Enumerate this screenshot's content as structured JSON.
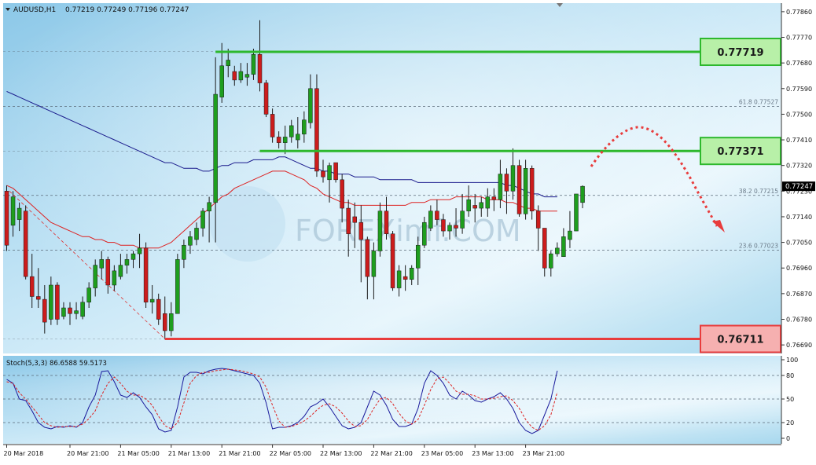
{
  "chart_data": [
    {
      "type": "candlestick",
      "title": "AUDUSD,H1",
      "ohlc_header": "0.77219 0.77249 0.77196 0.77247",
      "ylim": [
        0.7666,
        0.7789
      ],
      "y_tick_labels": [
        "0.77860",
        "0.77770",
        "0.77680",
        "0.77590",
        "0.77500",
        "0.77410",
        "0.77320",
        "0.77230",
        "0.77140",
        "0.77050",
        "0.76960",
        "0.76870",
        "0.76780",
        "0.76690"
      ],
      "x_tick_labels": [
        "20 Mar 2018",
        "20 Mar 21:00",
        "21 Mar 05:00",
        "21 Mar 13:00",
        "21 Mar 21:00",
        "22 Mar 05:00",
        "22 Mar 13:00",
        "22 Mar 21:00",
        "23 Mar 05:00",
        "23 Mar 13:00",
        "23 Mar 21:00"
      ],
      "x_tick_bar_index": [
        0,
        10,
        18,
        26,
        34,
        42,
        50,
        58,
        66,
        74,
        82
      ],
      "current_price": "0.77247",
      "bullish_color": "#1e9e1e",
      "bearish_color": "#cc1c1c",
      "moving_averages": [
        {
          "color": "#1a1a8c",
          "values": [
            0.7758,
            0.7757,
            0.7756,
            0.7755,
            0.7754,
            0.7753,
            0.7752,
            0.7751,
            0.775,
            0.7749,
            0.7748,
            0.7747,
            0.7746,
            0.7745,
            0.7744,
            0.7743,
            0.7742,
            0.7741,
            0.774,
            0.7739,
            0.7738,
            0.7737,
            0.7736,
            0.7735,
            0.7734,
            0.7733,
            0.7733,
            0.7732,
            0.7731,
            0.7731,
            0.7731,
            0.773,
            0.773,
            0.7731,
            0.7732,
            0.7732,
            0.7733,
            0.7733,
            0.7733,
            0.7734,
            0.7734,
            0.7734,
            0.7734,
            0.7735,
            0.7735,
            0.7734,
            0.7733,
            0.7732,
            0.7731,
            0.7731,
            0.773,
            0.773,
            0.7729,
            0.7729,
            0.7729,
            0.7728,
            0.7728,
            0.7728,
            0.7728,
            0.7727,
            0.7727,
            0.7727,
            0.7727,
            0.7727,
            0.7727,
            0.7726,
            0.7726,
            0.7726,
            0.7726,
            0.7726,
            0.7726,
            0.7726,
            0.7726,
            0.7726,
            0.7726,
            0.7726,
            0.7726,
            0.7726,
            0.7726,
            0.7725,
            0.7725,
            0.7724,
            0.7723,
            0.7722,
            0.7722,
            0.7721,
            0.7721,
            0.7721
          ]
        },
        {
          "color": "#dd2222",
          "values": [
            0.7725,
            0.7724,
            0.7722,
            0.772,
            0.7718,
            0.7716,
            0.7714,
            0.7712,
            0.7711,
            0.771,
            0.7709,
            0.7708,
            0.7707,
            0.7707,
            0.7706,
            0.7706,
            0.7705,
            0.7705,
            0.7704,
            0.7704,
            0.7704,
            0.7703,
            0.7703,
            0.7703,
            0.7703,
            0.7704,
            0.7705,
            0.7707,
            0.7709,
            0.7711,
            0.7713,
            0.7715,
            0.7717,
            0.7719,
            0.7721,
            0.7722,
            0.7724,
            0.7725,
            0.7726,
            0.7727,
            0.7728,
            0.7729,
            0.773,
            0.773,
            0.773,
            0.7729,
            0.7728,
            0.7727,
            0.7725,
            0.7724,
            0.7722,
            0.7721,
            0.772,
            0.7719,
            0.7719,
            0.7718,
            0.7718,
            0.7718,
            0.7718,
            0.7718,
            0.7718,
            0.7718,
            0.7718,
            0.7718,
            0.7719,
            0.7719,
            0.7719,
            0.772,
            0.772,
            0.772,
            0.772,
            0.7721,
            0.7721,
            0.7721,
            0.7721,
            0.7721,
            0.772,
            0.772,
            0.772,
            0.7719,
            0.7719,
            0.7718,
            0.7717,
            0.7717,
            0.7716,
            0.7716,
            0.7716,
            0.7716
          ]
        }
      ],
      "candles": [
        {
          "o": 0.7723,
          "h": 0.7725,
          "l": 0.7702,
          "c": 0.7704
        },
        {
          "o": 0.7711,
          "h": 0.7723,
          "l": 0.7707,
          "c": 0.7721
        },
        {
          "o": 0.7713,
          "h": 0.7719,
          "l": 0.7709,
          "c": 0.7717
        },
        {
          "o": 0.7716,
          "h": 0.7718,
          "l": 0.7692,
          "c": 0.7693
        },
        {
          "o": 0.7693,
          "h": 0.7701,
          "l": 0.7682,
          "c": 0.7686
        },
        {
          "o": 0.7686,
          "h": 0.7696,
          "l": 0.7682,
          "c": 0.7685
        },
        {
          "o": 0.7685,
          "h": 0.769,
          "l": 0.7673,
          "c": 0.7677
        },
        {
          "o": 0.7678,
          "h": 0.7693,
          "l": 0.7676,
          "c": 0.769
        },
        {
          "o": 0.769,
          "h": 0.7691,
          "l": 0.7676,
          "c": 0.7678
        },
        {
          "o": 0.7679,
          "h": 0.7684,
          "l": 0.7678,
          "c": 0.7682
        },
        {
          "o": 0.7682,
          "h": 0.7684,
          "l": 0.7676,
          "c": 0.768
        },
        {
          "o": 0.768,
          "h": 0.7684,
          "l": 0.7678,
          "c": 0.7681
        },
        {
          "o": 0.7679,
          "h": 0.7686,
          "l": 0.7678,
          "c": 0.7684
        },
        {
          "o": 0.7684,
          "h": 0.7691,
          "l": 0.7682,
          "c": 0.7689
        },
        {
          "o": 0.7689,
          "h": 0.7699,
          "l": 0.7686,
          "c": 0.7697
        },
        {
          "o": 0.7696,
          "h": 0.7702,
          "l": 0.7692,
          "c": 0.7699
        },
        {
          "o": 0.7699,
          "h": 0.77,
          "l": 0.7687,
          "c": 0.769
        },
        {
          "o": 0.769,
          "h": 0.7697,
          "l": 0.7688,
          "c": 0.7695
        },
        {
          "o": 0.7693,
          "h": 0.7701,
          "l": 0.7692,
          "c": 0.7697
        },
        {
          "o": 0.7697,
          "h": 0.7701,
          "l": 0.7694,
          "c": 0.7699
        },
        {
          "o": 0.7699,
          "h": 0.7702,
          "l": 0.7696,
          "c": 0.7701
        },
        {
          "o": 0.7701,
          "h": 0.7708,
          "l": 0.7696,
          "c": 0.7703
        },
        {
          "o": 0.7703,
          "h": 0.7705,
          "l": 0.7682,
          "c": 0.7684
        },
        {
          "o": 0.7684,
          "h": 0.769,
          "l": 0.768,
          "c": 0.7685
        },
        {
          "o": 0.7685,
          "h": 0.7687,
          "l": 0.7676,
          "c": 0.7678
        },
        {
          "o": 0.768,
          "h": 0.7686,
          "l": 0.7671,
          "c": 0.7674
        },
        {
          "o": 0.7674,
          "h": 0.7684,
          "l": 0.7672,
          "c": 0.768
        },
        {
          "o": 0.768,
          "h": 0.7701,
          "l": 0.768,
          "c": 0.7699
        },
        {
          "o": 0.7699,
          "h": 0.7706,
          "l": 0.7696,
          "c": 0.7704
        },
        {
          "o": 0.7704,
          "h": 0.7709,
          "l": 0.7701,
          "c": 0.7707
        },
        {
          "o": 0.7706,
          "h": 0.7712,
          "l": 0.7704,
          "c": 0.771
        },
        {
          "o": 0.771,
          "h": 0.7717,
          "l": 0.7707,
          "c": 0.7716
        },
        {
          "o": 0.7716,
          "h": 0.7721,
          "l": 0.7705,
          "c": 0.7719
        },
        {
          "o": 0.7719,
          "h": 0.777,
          "l": 0.7705,
          "c": 0.7757
        },
        {
          "o": 0.7756,
          "h": 0.7775,
          "l": 0.7754,
          "c": 0.7767
        },
        {
          "o": 0.7767,
          "h": 0.7773,
          "l": 0.7763,
          "c": 0.7769
        },
        {
          "o": 0.7765,
          "h": 0.7767,
          "l": 0.776,
          "c": 0.7762
        },
        {
          "o": 0.7762,
          "h": 0.7768,
          "l": 0.7761,
          "c": 0.7765
        },
        {
          "o": 0.7763,
          "h": 0.7768,
          "l": 0.776,
          "c": 0.7764
        },
        {
          "o": 0.7764,
          "h": 0.7773,
          "l": 0.7762,
          "c": 0.7771
        },
        {
          "o": 0.7771,
          "h": 0.7783,
          "l": 0.7758,
          "c": 0.7761
        },
        {
          "o": 0.7761,
          "h": 0.7762,
          "l": 0.7749,
          "c": 0.775
        },
        {
          "o": 0.775,
          "h": 0.7752,
          "l": 0.774,
          "c": 0.7742
        },
        {
          "o": 0.7742,
          "h": 0.7744,
          "l": 0.7738,
          "c": 0.774
        },
        {
          "o": 0.774,
          "h": 0.7746,
          "l": 0.7736,
          "c": 0.7742
        },
        {
          "o": 0.7742,
          "h": 0.7748,
          "l": 0.774,
          "c": 0.7746
        },
        {
          "o": 0.7741,
          "h": 0.7749,
          "l": 0.7738,
          "c": 0.7743
        },
        {
          "o": 0.7743,
          "h": 0.7751,
          "l": 0.774,
          "c": 0.7748
        },
        {
          "o": 0.7747,
          "h": 0.7764,
          "l": 0.7745,
          "c": 0.7759
        },
        {
          "o": 0.7759,
          "h": 0.7764,
          "l": 0.7728,
          "c": 0.773
        },
        {
          "o": 0.773,
          "h": 0.7734,
          "l": 0.7726,
          "c": 0.7728
        },
        {
          "o": 0.7727,
          "h": 0.7733,
          "l": 0.7719,
          "c": 0.7732
        },
        {
          "o": 0.7733,
          "h": 0.7733,
          "l": 0.7726,
          "c": 0.7727
        },
        {
          "o": 0.7727,
          "h": 0.7729,
          "l": 0.7712,
          "c": 0.7717
        },
        {
          "o": 0.7717,
          "h": 0.772,
          "l": 0.77,
          "c": 0.7708
        },
        {
          "o": 0.7714,
          "h": 0.7719,
          "l": 0.7703,
          "c": 0.7712
        },
        {
          "o": 0.7712,
          "h": 0.7718,
          "l": 0.7691,
          "c": 0.7706
        },
        {
          "o": 0.7706,
          "h": 0.7707,
          "l": 0.7685,
          "c": 0.7693
        },
        {
          "o": 0.7693,
          "h": 0.7705,
          "l": 0.7685,
          "c": 0.7702
        },
        {
          "o": 0.7702,
          "h": 0.7719,
          "l": 0.77,
          "c": 0.7716
        },
        {
          "o": 0.7716,
          "h": 0.7721,
          "l": 0.7706,
          "c": 0.7708
        },
        {
          "o": 0.7708,
          "h": 0.7709,
          "l": 0.7688,
          "c": 0.7689
        },
        {
          "o": 0.7689,
          "h": 0.7697,
          "l": 0.7686,
          "c": 0.7695
        },
        {
          "o": 0.7693,
          "h": 0.7697,
          "l": 0.7688,
          "c": 0.7692
        },
        {
          "o": 0.7692,
          "h": 0.7697,
          "l": 0.769,
          "c": 0.7696
        },
        {
          "o": 0.7696,
          "h": 0.7707,
          "l": 0.769,
          "c": 0.7704
        },
        {
          "o": 0.7704,
          "h": 0.7714,
          "l": 0.7703,
          "c": 0.7712
        },
        {
          "o": 0.771,
          "h": 0.7718,
          "l": 0.7709,
          "c": 0.7716
        },
        {
          "o": 0.7716,
          "h": 0.772,
          "l": 0.7711,
          "c": 0.7713
        },
        {
          "o": 0.7713,
          "h": 0.7715,
          "l": 0.7707,
          "c": 0.7709
        },
        {
          "o": 0.7709,
          "h": 0.7712,
          "l": 0.7706,
          "c": 0.7711
        },
        {
          "o": 0.7711,
          "h": 0.7717,
          "l": 0.7707,
          "c": 0.771
        },
        {
          "o": 0.771,
          "h": 0.7722,
          "l": 0.7708,
          "c": 0.7716
        },
        {
          "o": 0.7716,
          "h": 0.7725,
          "l": 0.7714,
          "c": 0.772
        },
        {
          "o": 0.7718,
          "h": 0.7722,
          "l": 0.7712,
          "c": 0.7717
        },
        {
          "o": 0.7717,
          "h": 0.7721,
          "l": 0.7714,
          "c": 0.7719
        },
        {
          "o": 0.7717,
          "h": 0.7724,
          "l": 0.7714,
          "c": 0.7721
        },
        {
          "o": 0.7721,
          "h": 0.7724,
          "l": 0.7716,
          "c": 0.772
        },
        {
          "o": 0.772,
          "h": 0.7734,
          "l": 0.7717,
          "c": 0.7729
        },
        {
          "o": 0.7729,
          "h": 0.7731,
          "l": 0.7715,
          "c": 0.7723
        },
        {
          "o": 0.7723,
          "h": 0.7738,
          "l": 0.772,
          "c": 0.7732
        },
        {
          "o": 0.7732,
          "h": 0.7734,
          "l": 0.7714,
          "c": 0.7715
        },
        {
          "o": 0.7715,
          "h": 0.7734,
          "l": 0.7713,
          "c": 0.7731
        },
        {
          "o": 0.7731,
          "h": 0.7732,
          "l": 0.7713,
          "c": 0.7716
        },
        {
          "o": 0.7716,
          "h": 0.7718,
          "l": 0.7702,
          "c": 0.771
        },
        {
          "o": 0.771,
          "h": 0.771,
          "l": 0.7693,
          "c": 0.7696
        },
        {
          "o": 0.7696,
          "h": 0.7702,
          "l": 0.7693,
          "c": 0.7701
        },
        {
          "o": 0.7701,
          "h": 0.7705,
          "l": 0.77,
          "c": 0.7703
        },
        {
          "o": 0.77,
          "h": 0.771,
          "l": 0.77,
          "c": 0.7707
        },
        {
          "o": 0.7706,
          "h": 0.7716,
          "l": 0.7703,
          "c": 0.7709
        },
        {
          "o": 0.7709,
          "h": 0.7722,
          "l": 0.7709,
          "c": 0.7722
        },
        {
          "o": 0.7719,
          "h": 0.7725,
          "l": 0.7717,
          "c": 0.77247
        }
      ],
      "levels": [
        {
          "value": 0.77719,
          "label": "0.77719",
          "color": "#2db82d",
          "box_fill": "#b8f0a8"
        },
        {
          "value": 0.77371,
          "label": "0.77371",
          "color": "#2db82d",
          "box_fill": "#b8f0a8"
        },
        {
          "value": 0.76711,
          "label": "0.76711",
          "color": "#e83c3c",
          "box_fill": "#f6b0b0"
        }
      ],
      "fibonacci": [
        {
          "value": 0.77527,
          "label": "61.8   0.77527"
        },
        {
          "value": 0.77215,
          "label": "38.2   0.77215"
        },
        {
          "value": 0.77023,
          "label": "23.6   0.77023"
        }
      ],
      "watermark": "FOREXimf.COM"
    },
    {
      "type": "line",
      "title": "Stoch(5,3,3) 86.6588 59.5173",
      "ylim": [
        0,
        100
      ],
      "y_tick_labels": [
        "100",
        "80",
        "50",
        "20",
        "0"
      ],
      "y_tick_values": [
        100,
        80,
        50,
        20,
        0
      ],
      "series": [
        {
          "color": "#1a1a9c",
          "values": [
            75,
            70,
            50,
            48,
            35,
            20,
            14,
            12,
            15,
            14,
            16,
            14,
            20,
            40,
            55,
            85,
            86,
            72,
            55,
            52,
            58,
            52,
            40,
            30,
            12,
            8,
            10,
            40,
            78,
            84,
            84,
            82,
            86,
            88,
            89,
            88,
            86,
            84,
            82,
            80,
            70,
            45,
            12,
            14,
            14,
            16,
            20,
            28,
            40,
            44,
            50,
            40,
            28,
            16,
            12,
            14,
            20,
            40,
            60,
            55,
            42,
            24,
            15,
            15,
            18,
            38,
            70,
            86,
            80,
            70,
            55,
            50,
            60,
            55,
            48,
            46,
            50,
            53,
            58,
            50,
            38,
            20,
            10,
            6,
            10,
            30,
            50,
            86
          ]
        },
        {
          "color": "#dd2222",
          "values": [
            72,
            70,
            58,
            50,
            40,
            30,
            20,
            16,
            14,
            15,
            15,
            15,
            18,
            25,
            35,
            55,
            70,
            78,
            70,
            60,
            55,
            55,
            50,
            42,
            28,
            16,
            12,
            20,
            45,
            70,
            80,
            84,
            84,
            86,
            87,
            88,
            87,
            86,
            84,
            82,
            78,
            65,
            42,
            22,
            14,
            15,
            18,
            22,
            28,
            36,
            42,
            44,
            40,
            32,
            22,
            15,
            16,
            24,
            38,
            50,
            52,
            44,
            32,
            22,
            18,
            24,
            42,
            62,
            76,
            78,
            70,
            60,
            56,
            56,
            54,
            50,
            50,
            51,
            53,
            54,
            48,
            38,
            24,
            14,
            10,
            16,
            30,
            59
          ]
        }
      ]
    }
  ]
}
